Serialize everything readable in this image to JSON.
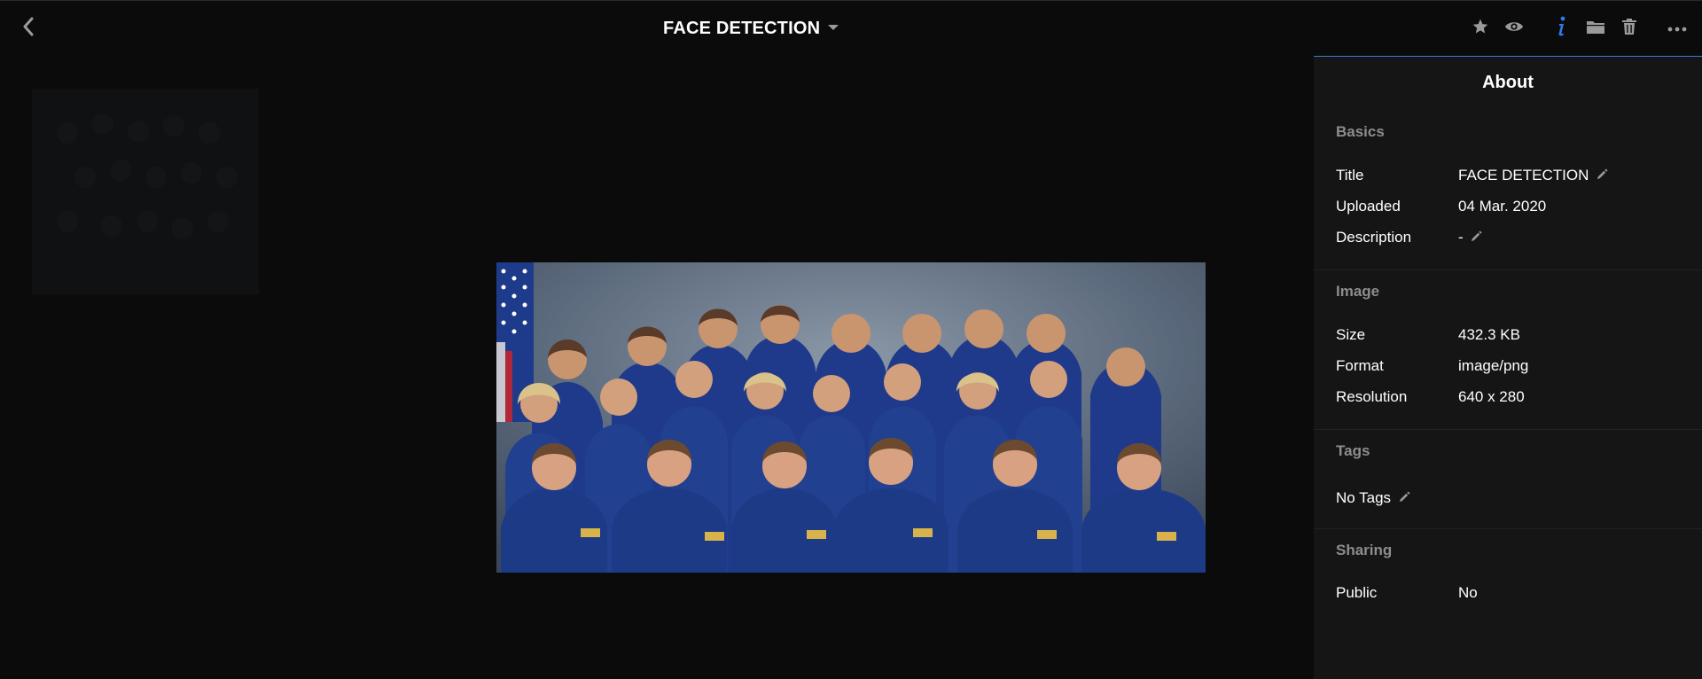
{
  "header": {
    "title": "FACE DETECTION",
    "icons": {
      "back": "chevron-left-icon",
      "title_dropdown": "caret-down-icon",
      "star": "star-icon",
      "eye": "eye-icon",
      "info": "info-icon",
      "folder": "folder-icon",
      "trash": "trash-icon",
      "more": "more-horizontal-icon"
    },
    "colors": {
      "info_active": "#2f7ce8",
      "icon_default": "#9a9a9a"
    }
  },
  "panel": {
    "title": "About",
    "accent": "#3a7bd5",
    "basics": {
      "label": "Basics",
      "title_key": "Title",
      "title_value": "FACE DETECTION",
      "uploaded_key": "Uploaded",
      "uploaded_value": "04 Mar. 2020",
      "description_key": "Description",
      "description_value": "-"
    },
    "image": {
      "label": "Image",
      "size_key": "Size",
      "size_value": "432.3 KB",
      "format_key": "Format",
      "format_value": "image/png",
      "resolution_key": "Resolution",
      "resolution_value": "640 x 280"
    },
    "tags": {
      "label": "Tags",
      "value": "No Tags"
    },
    "sharing": {
      "label": "Sharing",
      "public_key": "Public",
      "public_value": "No"
    }
  }
}
